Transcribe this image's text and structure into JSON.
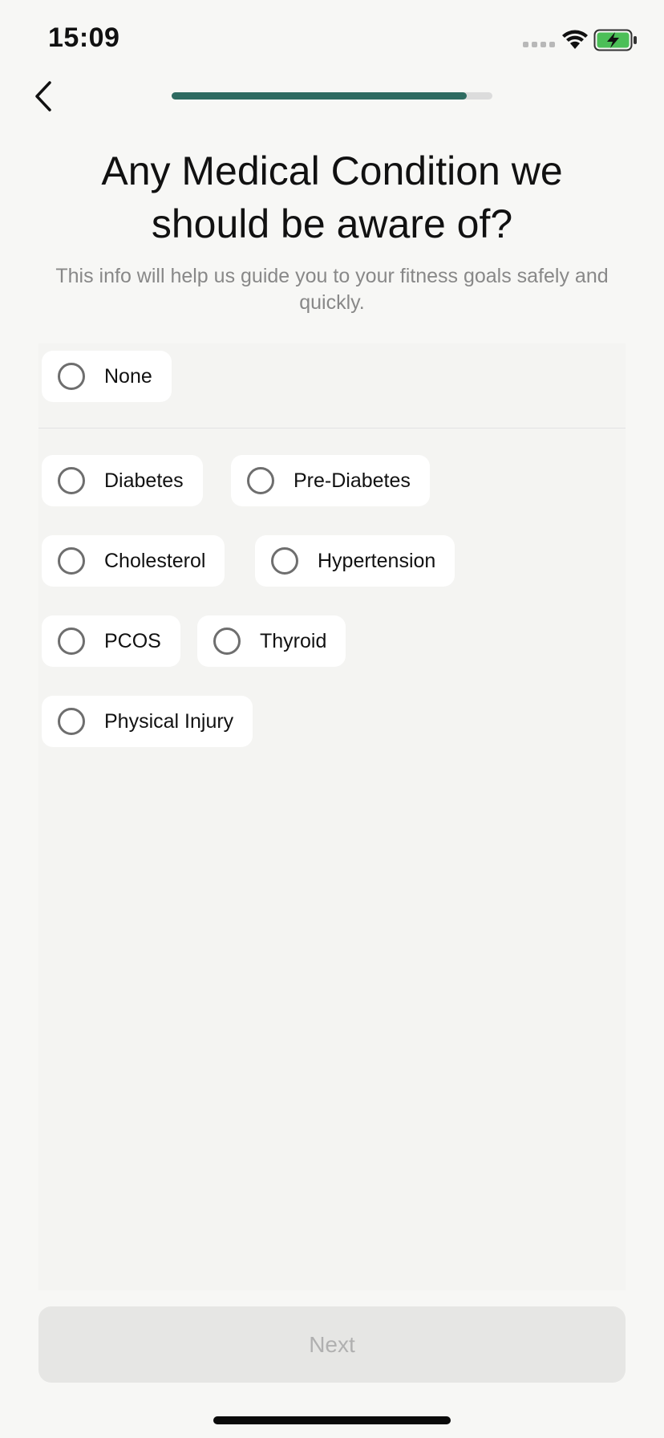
{
  "status_bar": {
    "time": "15:09",
    "icons": [
      "signal-icon",
      "wifi-icon",
      "battery-charging-icon"
    ],
    "battery_color": "#4cbf57"
  },
  "header": {
    "back_icon": "chevron-left-icon",
    "progress": 0.92,
    "progress_color": "#2e6b61"
  },
  "question": {
    "title": "Any Medical Condition we should be aware of?",
    "subtitle": "This info will help us guide you to your fitness goals safely and quickly."
  },
  "options": [
    {
      "label": "None",
      "selected": false
    },
    {
      "label": "Diabetes",
      "selected": false
    },
    {
      "label": "Pre-Diabetes",
      "selected": false
    },
    {
      "label": "Cholesterol",
      "selected": false
    },
    {
      "label": "Hypertension",
      "selected": false
    },
    {
      "label": "PCOS",
      "selected": false
    },
    {
      "label": "Thyroid",
      "selected": false
    },
    {
      "label": "Physical Injury",
      "selected": false
    }
  ],
  "footer": {
    "next_label": "Next",
    "next_enabled": false
  }
}
